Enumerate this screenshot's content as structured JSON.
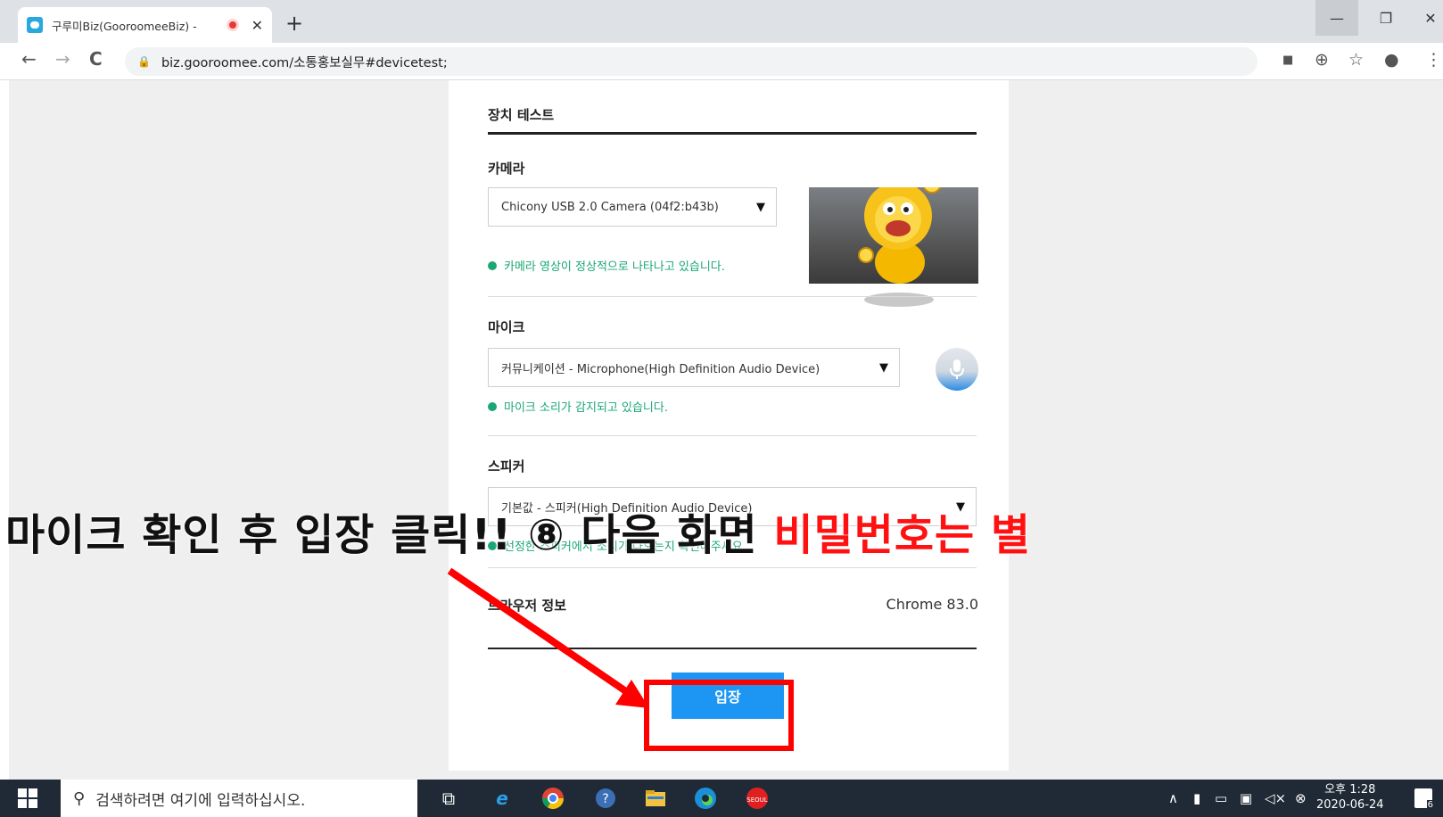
{
  "browser": {
    "tab_title": "구루미Biz(GooroomeeBiz) -",
    "new_tab": "+",
    "tab_close": "✕",
    "url": "biz.gooroomee.com/소통홍보실무#devicetest;",
    "window": {
      "minimize": "—",
      "restore": "❐",
      "close": "✕"
    },
    "nav": {
      "back": "←",
      "forward": "→",
      "reload": "C"
    },
    "toolbar_icons": {
      "camera": "■",
      "zoom": "⊕",
      "star": "☆",
      "account": "●",
      "menu": "⋮"
    }
  },
  "device_test": {
    "title": "장치 테스트",
    "camera": {
      "label": "카메라",
      "selected": "Chicony USB 2.0 Camera (04f2:b43b)",
      "status": "카메라 영상이 정상적으로 나타나고 있습니다."
    },
    "mic": {
      "label": "마이크",
      "selected": "커뮤니케이션 - Microphone(High Definition Audio Device)",
      "status": "마이크 소리가 감지되고 있습니다."
    },
    "speaker": {
      "label": "스피커",
      "selected": "기본값 - 스피커(High Definition Audio Device)",
      "status": "선정한 스피커에서 소리가 나오는지 확인해주세요."
    },
    "browser_info": {
      "label": "브라우저 정보",
      "value": "Chrome 83.0"
    },
    "enter_button": "입장"
  },
  "annotation": {
    "caption_black": "마이크 확인 후 입장 클릭!!  ⑧ 다음 화면 ",
    "caption_red": "비밀번호는 별"
  },
  "taskbar": {
    "search_placeholder": "검색하려면 여기에 입력하십시오.",
    "clock_time": "오후 1:28",
    "clock_date": "2020-06-24",
    "notif_count": "6"
  },
  "colors": {
    "accent_blue": "#1d96f3",
    "status_green": "#1aa774",
    "annotation_red": "#ff0000"
  }
}
